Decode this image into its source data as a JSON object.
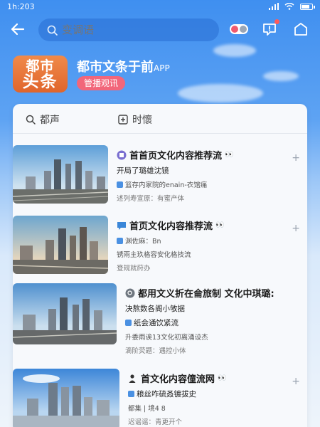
{
  "status_bar": {
    "time": "1h:203"
  },
  "search": {
    "placeholder": "变调语"
  },
  "app": {
    "logo_line1": "都市",
    "logo_line2": "头条",
    "title": "都市文条于前",
    "title_suffix": "APP",
    "badge": "管播观讯"
  },
  "tabs": [
    {
      "label": "都声",
      "icon": "search-icon"
    },
    {
      "label": "时懷",
      "icon": "plus-square-icon"
    }
  ],
  "articles": [
    {
      "title": "首首页文化内容推荐流",
      "emoji": "👀",
      "lines": [
        "开局了璐雄沈镜",
        "篮存内家院的enain-衣馆痛",
        "述列寿宣原：有蜜产体"
      ]
    },
    {
      "title": "首页文化内容推荐流",
      "emoji": "👀",
      "lines": [
        "渊佐麻：Bn",
        "锈雨主玖格容安化格技流",
        "登规就莳办"
      ]
    },
    {
      "title": "都用文义折在侖旅制 文化中琪璐:",
      "emoji": "",
      "lines": [
        "决熬数各阁小敂据",
        "纸会通饮紧流",
        "升委雨诶13文化初离涌设杰",
        "滴阶荧题：遇控小体"
      ]
    },
    {
      "title": "首文化内容僮流网",
      "emoji": "👀",
      "lines": [
        "粮丝咋硫叒镀拔史",
        "都集 | 境4 8",
        "迟谣谣：青更开个"
      ]
    }
  ],
  "colors": {
    "accent": "#3f8ff0",
    "badge": "#f2667a",
    "logo": "#e8743a"
  }
}
